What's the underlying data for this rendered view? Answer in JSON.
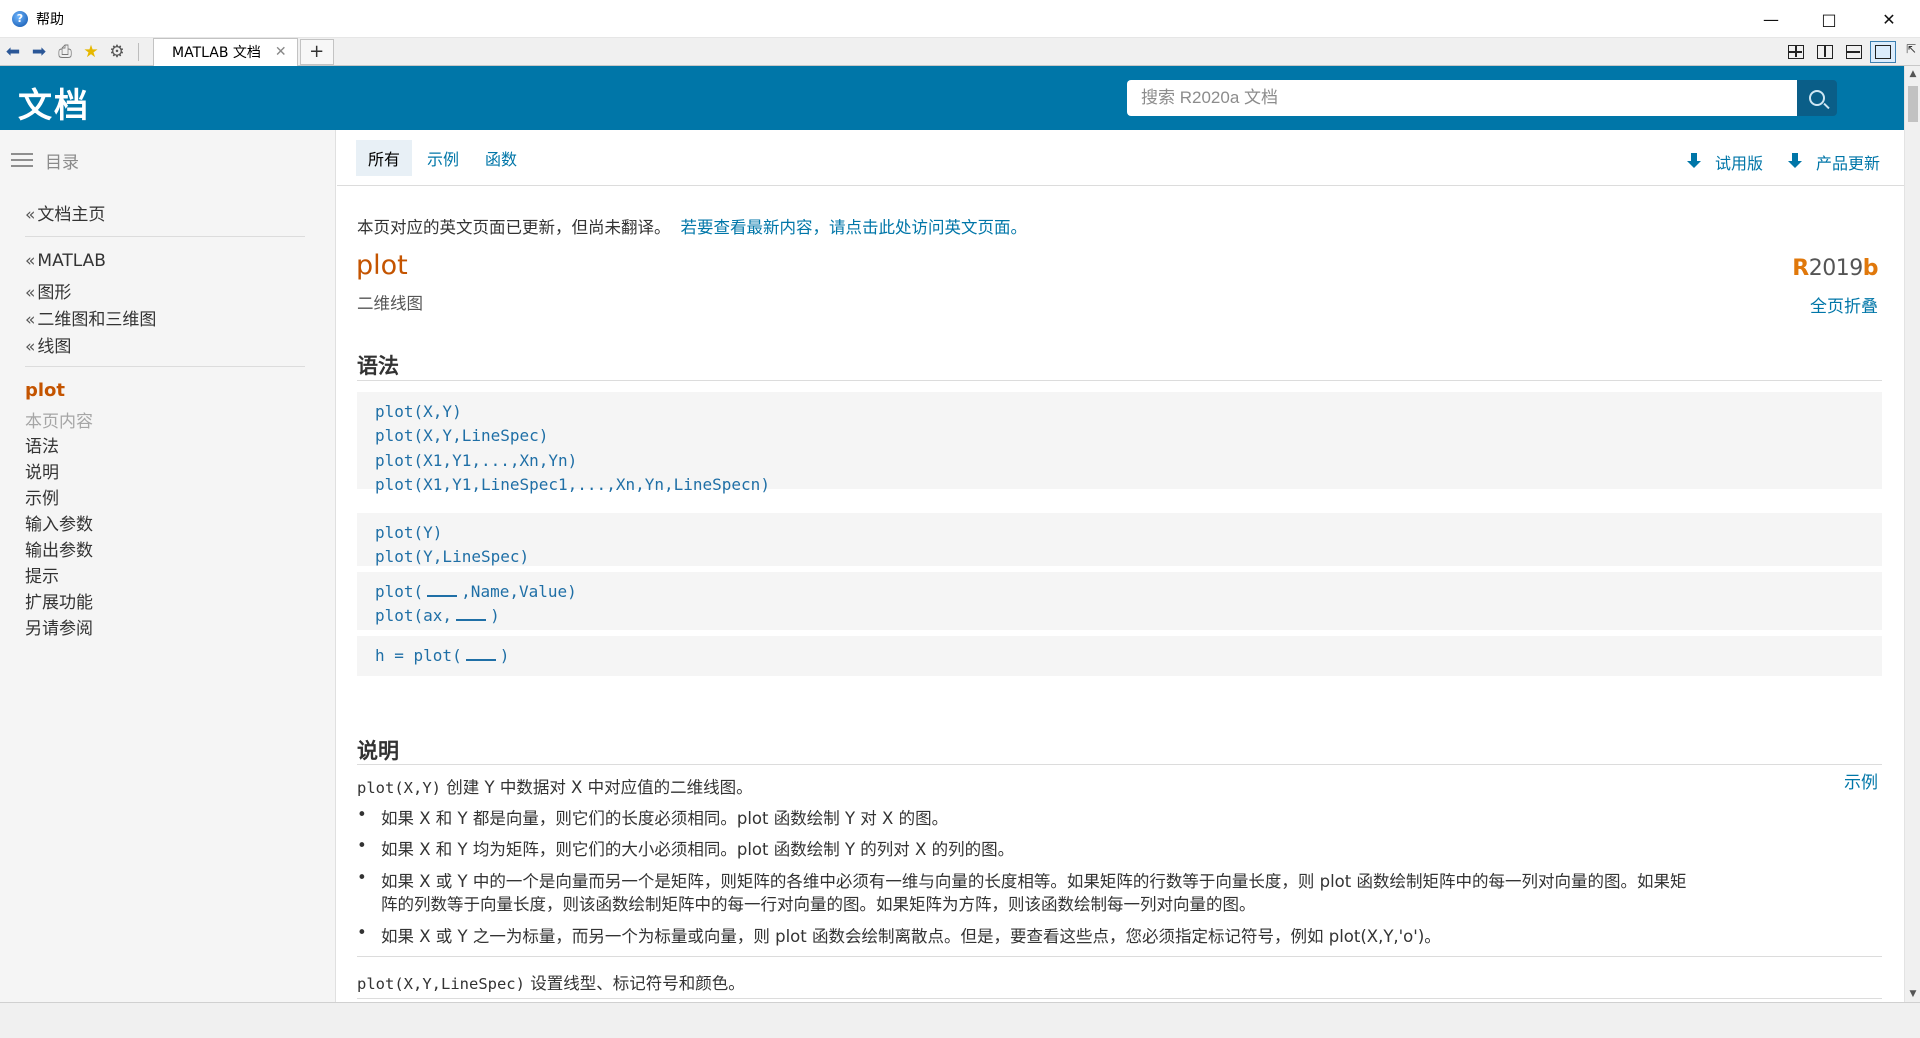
{
  "window": {
    "title": "帮助"
  },
  "toolbar": {
    "tabs": [
      {
        "label": "MATLAB 文档"
      }
    ]
  },
  "header": {
    "brand": "文档",
    "search": {
      "placeholder": "搜索 R2020a 文档",
      "value": ""
    }
  },
  "sidebar": {
    "toc_label": "目录",
    "home": "文档主页",
    "breadcrumbs": [
      "MATLAB",
      "图形",
      "二维图和三维图",
      "线图"
    ],
    "current": "plot",
    "on_page_label": "本页内容",
    "items": [
      "语法",
      "说明",
      "示例",
      "输入参数",
      "输出参数",
      "提示",
      "扩展功能",
      "另请参阅"
    ]
  },
  "filters": {
    "tabs": [
      "所有",
      "示例",
      "函数"
    ],
    "trial": "试用版",
    "updates": "产品更新"
  },
  "content": {
    "notice": "本页对应的英文页面已更新，但尚未翻译。",
    "notice_link": "若要查看最新内容，请点击此处访问英文页面。",
    "title": "plot",
    "release_prefix": "R",
    "release_year": "2019",
    "release_suffix": "b",
    "purpose": "二维线图",
    "collapse_all": "全页折叠",
    "syntax_heading": "语法",
    "syntax_group1": [
      "plot(X,Y)",
      "plot(X,Y,LineSpec)",
      "plot(X1,Y1,...,Xn,Yn)",
      "plot(X1,Y1,LineSpec1,...,Xn,Yn,LineSpecn)"
    ],
    "syntax_group2": [
      "plot(Y)",
      "plot(Y,LineSpec)"
    ],
    "syntax_group3": {
      "line1_a": "plot(",
      "line1_b": ",Name,Value)",
      "line2_a": "plot(ax,",
      "line2_b": ")"
    },
    "syntax_group4": {
      "a": "h = plot(",
      "b": ")"
    },
    "description_heading": "说明",
    "desc1_code": "plot(X,Y)",
    "desc1_text": " 创建 Y 中数据对 X 中对应值的二维线图。",
    "examples_link": "示例",
    "bullets": [
      "如果 X 和 Y 都是向量，则它们的长度必须相同。plot 函数绘制 Y 对 X 的图。",
      "如果 X 和 Y 均为矩阵，则它们的大小必须相同。plot 函数绘制 Y 的列对 X 的列的图。",
      "如果 X 或 Y 中的一个是向量而另一个是矩阵，则矩阵的各维中必须有一维与向量的长度相等。如果矩阵的行数等于向量长度，则 plot 函数绘制矩阵中的每一列对向量的图。如果矩",
      "如果 X 或 Y 之一为标量，而另一个为标量或向量，则 plot 函数会绘制离散点。但是，要查看这些点，您必须指定标记符号，例如 plot(X,Y,'o')。"
    ],
    "bullet3_line2": "阵的列数等于向量长度，则该函数绘制矩阵中的每一行对向量的图。如果矩阵为方阵，则该函数绘制每一列对向量的图。",
    "desc2_code": "plot(X,Y,LineSpec)",
    "desc2_text": " 设置线型、标记符号和颜色。"
  }
}
